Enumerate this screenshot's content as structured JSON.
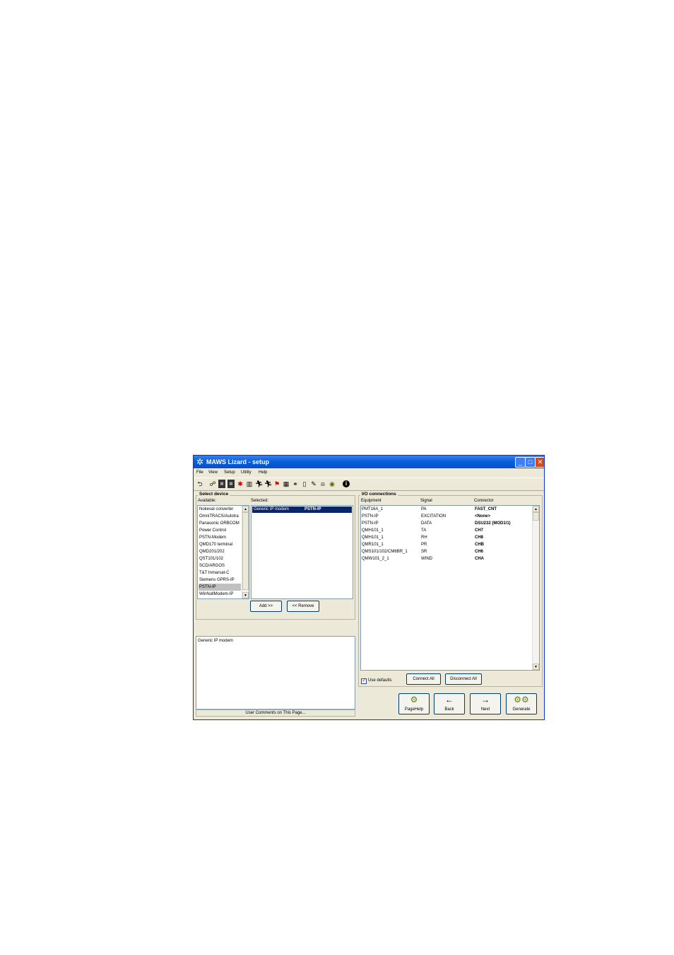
{
  "window": {
    "title": "MAWS Lizard - setup",
    "app_icon": "lizard-icon",
    "minimize_icon": "minimize-icon",
    "maximize_icon": "maximize-icon",
    "close_icon": "close-icon"
  },
  "menu": {
    "file": "File",
    "view": "View",
    "setup": "Setup",
    "utility": "Utility",
    "help": "Help"
  },
  "toolbar_icons": [
    "back-arrow-icon",
    "network-icon",
    "device-icon",
    "device2-icon",
    "sensor-icon",
    "logger-icon",
    "runner-icon",
    "runner2-icon",
    "flag-icon",
    "calc-icon",
    "bike-icon",
    "page-icon",
    "pen-icon",
    "alarm-icon",
    "globe-icon",
    "info-icon"
  ],
  "select_device": {
    "title": "Select device",
    "available_label": "Available:",
    "selected_label": "Selected:",
    "available": [
      "Nokeval converter",
      "OmniTRACS/Autotra",
      "Panasonic ORBCOM",
      "Power Control",
      "PSTN-Modem",
      "QMD170 terminal",
      "QMD201/202",
      "QST101/102",
      "SCD/ARGOS",
      "T&T Inmarsat-C",
      "Siemens GPRS-IP",
      "PSTN-IP",
      "WinNullModem-IP"
    ],
    "selected_available_index": 11,
    "selected_item": {
      "name": "Generic IP modem",
      "type": "PSTN-IP"
    },
    "add_button": "Add >>",
    "remove_button": "<< Remove"
  },
  "description": {
    "text": "Generic IP modem",
    "footer": "User Comments on This Page..."
  },
  "io": {
    "title": "I/O connections",
    "headers": [
      "Equipment",
      "Signal",
      "Connector"
    ],
    "rows": [
      [
        "PMT16A_1",
        "PA",
        "FAST_CNT"
      ],
      [
        "PSTN-IP",
        "EXCITATION",
        "<None>"
      ],
      [
        "PSTN-IP",
        "DATA",
        "DSU232 (MOD1/1)"
      ],
      [
        "QMH101_1",
        "TA",
        "CH7"
      ],
      [
        "QMH101_1",
        "RH",
        "CH8"
      ],
      [
        "QMR101_1",
        "PR",
        "CHB"
      ],
      [
        "QMS101/102/CM6BR_1",
        "SR",
        "CH6"
      ],
      [
        "QMW101_2_1",
        "WIND",
        "CHA"
      ]
    ],
    "use_defaults": "Use defaults",
    "use_defaults_checked": true,
    "connect_all": "Connect All",
    "disconnect_all": "Disconnect All"
  },
  "nav": {
    "pagehelp": {
      "label": "PageHelp",
      "icon": "help-icon"
    },
    "back": {
      "label": "Back",
      "icon": "left-arrow-icon"
    },
    "next": {
      "label": "Next",
      "icon": "right-arrow-icon"
    },
    "generate": {
      "label": "Generate",
      "icon": "gears-icon"
    }
  }
}
